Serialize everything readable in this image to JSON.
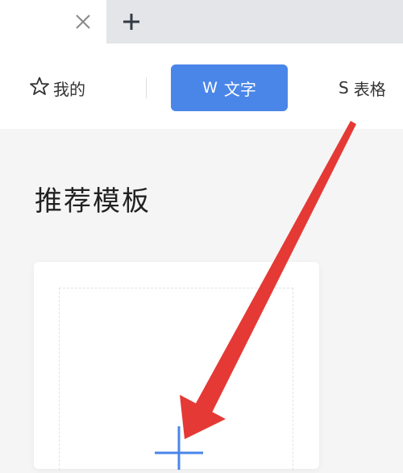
{
  "tab_bar": {
    "close_icon": "close-icon",
    "new_tab_icon": "plus-icon"
  },
  "categories": {
    "mine_label": "我的",
    "mine_icon": "star-outline-icon",
    "writer_label": "文字",
    "writer_glyph": "W",
    "sheet_label": "表格",
    "sheet_glyph": "S"
  },
  "main": {
    "section_title": "推荐模板",
    "new_template_icon": "plus-icon"
  },
  "colors": {
    "accent": "#4a86e8",
    "annotation_arrow": "#e53935"
  }
}
